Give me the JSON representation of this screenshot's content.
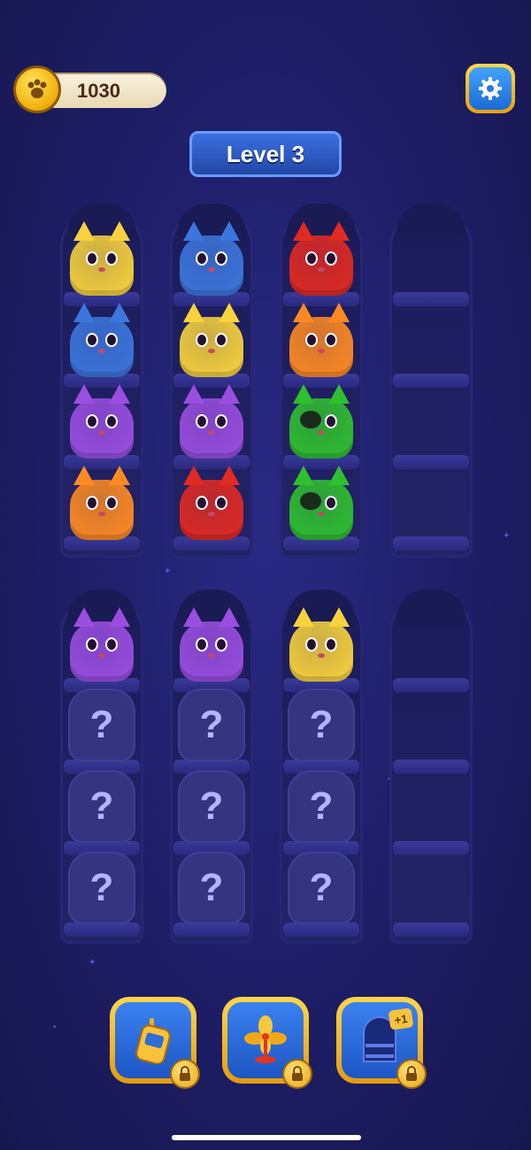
{
  "hud": {
    "coins": "1030",
    "level_label": "Level 3"
  },
  "colors": {
    "yellow": "#f7d23c",
    "blue": "#3c76dc",
    "red": "#e12a22",
    "orange": "#ff8a22",
    "purple": "#9a4ee0",
    "green": "#2fbf2f"
  },
  "mystery_symbol": "?",
  "tubes": [
    {
      "row": 1,
      "col": 1,
      "slots": [
        "yellow",
        "blue",
        "purple",
        "orange"
      ]
    },
    {
      "row": 1,
      "col": 2,
      "slots": [
        "blue",
        "yellow",
        "purple",
        "red"
      ]
    },
    {
      "row": 1,
      "col": 3,
      "slots": [
        "red",
        "orange",
        "green-patch",
        "green-patch"
      ]
    },
    {
      "row": 1,
      "col": 4,
      "slots": []
    },
    {
      "row": 2,
      "col": 1,
      "slots": [
        "purple",
        "mystery",
        "mystery",
        "mystery"
      ]
    },
    {
      "row": 2,
      "col": 2,
      "slots": [
        "purple",
        "mystery",
        "mystery",
        "mystery"
      ]
    },
    {
      "row": 2,
      "col": 3,
      "slots": [
        "yellow",
        "mystery",
        "mystery",
        "mystery"
      ]
    },
    {
      "row": 2,
      "col": 4,
      "slots": []
    }
  ],
  "boosters": [
    {
      "name": "walkie-talkie",
      "icon": "walkie-talkie-icon",
      "locked": true
    },
    {
      "name": "fan",
      "icon": "fan-icon",
      "locked": true
    },
    {
      "name": "extra-tube",
      "icon": "extra-tube-icon",
      "badge": "+1",
      "locked": true
    }
  ]
}
